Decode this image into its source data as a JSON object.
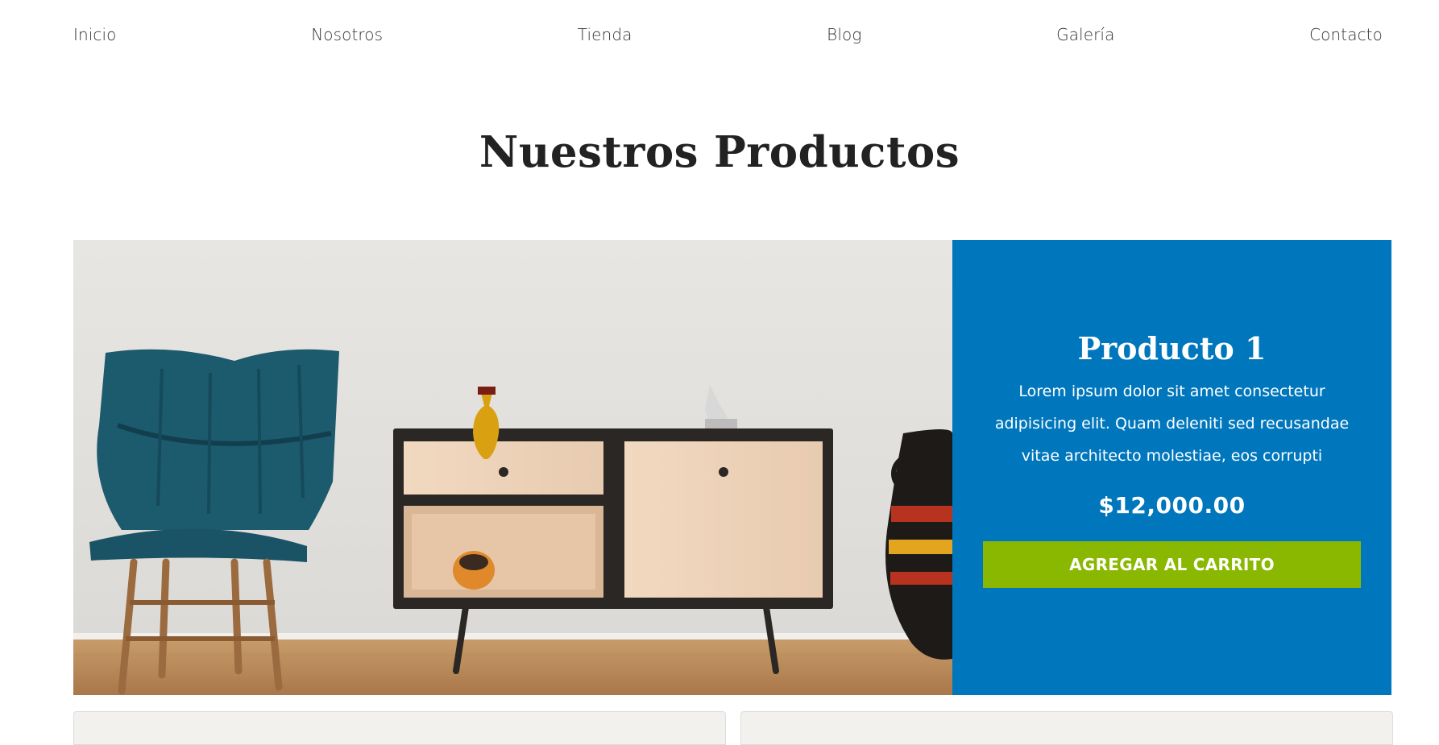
{
  "nav": {
    "items": [
      {
        "label": "Inicio"
      },
      {
        "label": "Nosotros"
      },
      {
        "label": "Tienda"
      },
      {
        "label": "Blog"
      },
      {
        "label": "Galería"
      },
      {
        "label": "Contacto"
      }
    ]
  },
  "page": {
    "title": "Nuestros Productos"
  },
  "product": {
    "name": "Producto 1",
    "description": "Lorem ipsum dolor sit amet consectetur adipisicing elit. Quam deleniti sed recusandae vitae architecto molestiae, eos corrupti",
    "price": "$12,000.00",
    "button_label": "AGREGAR AL CARRITO",
    "image_alt": "furniture-scene"
  },
  "colors": {
    "info_panel": "#0077bd",
    "cart_button": "#8ab800",
    "text_dark": "#222222"
  }
}
